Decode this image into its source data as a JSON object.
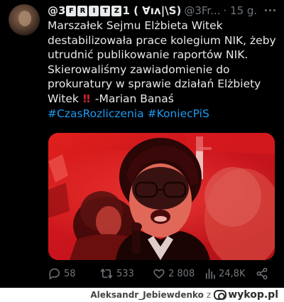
{
  "tweet": {
    "author": {
      "name_prefix": "@3",
      "name_boxed": [
        "F",
        "R",
        "I",
        "T",
        "Z"
      ],
      "name_suffix": "1 ( ∀ıʌ|\\S)",
      "handle": "@3Fr...",
      "time": "· 15 g."
    },
    "text": {
      "line1": "Marszałek Sejmu Elżbieta Witek",
      "line2": "destabilizowała prace kolegium NIK, żeby",
      "line3": "utrudnić publikowanie raportów NIK.",
      "line4": "Skierowaliśmy zawiadomienie do",
      "line5": "prokuratury w sprawie działań Elżbiety",
      "line6_start": "Witek",
      "line6_emoji": "!!",
      "line6_end": " -Marian Banaś",
      "hashtag1": "#CzasRozliczenia",
      "hashtag2": "#KoniecPiS"
    },
    "actions": {
      "replies": "58",
      "retweets": "533",
      "likes": "2 808",
      "views": "24,8K"
    }
  },
  "footer": {
    "username": "Aleksandr_Jebiewdenko",
    "connector": "z",
    "site": "wykop.pl"
  },
  "colors": {
    "background": "#000000",
    "text": "#e7e9ea",
    "muted": "#71767b",
    "link": "#1d9bf0",
    "media_tint": "#c8141c"
  }
}
